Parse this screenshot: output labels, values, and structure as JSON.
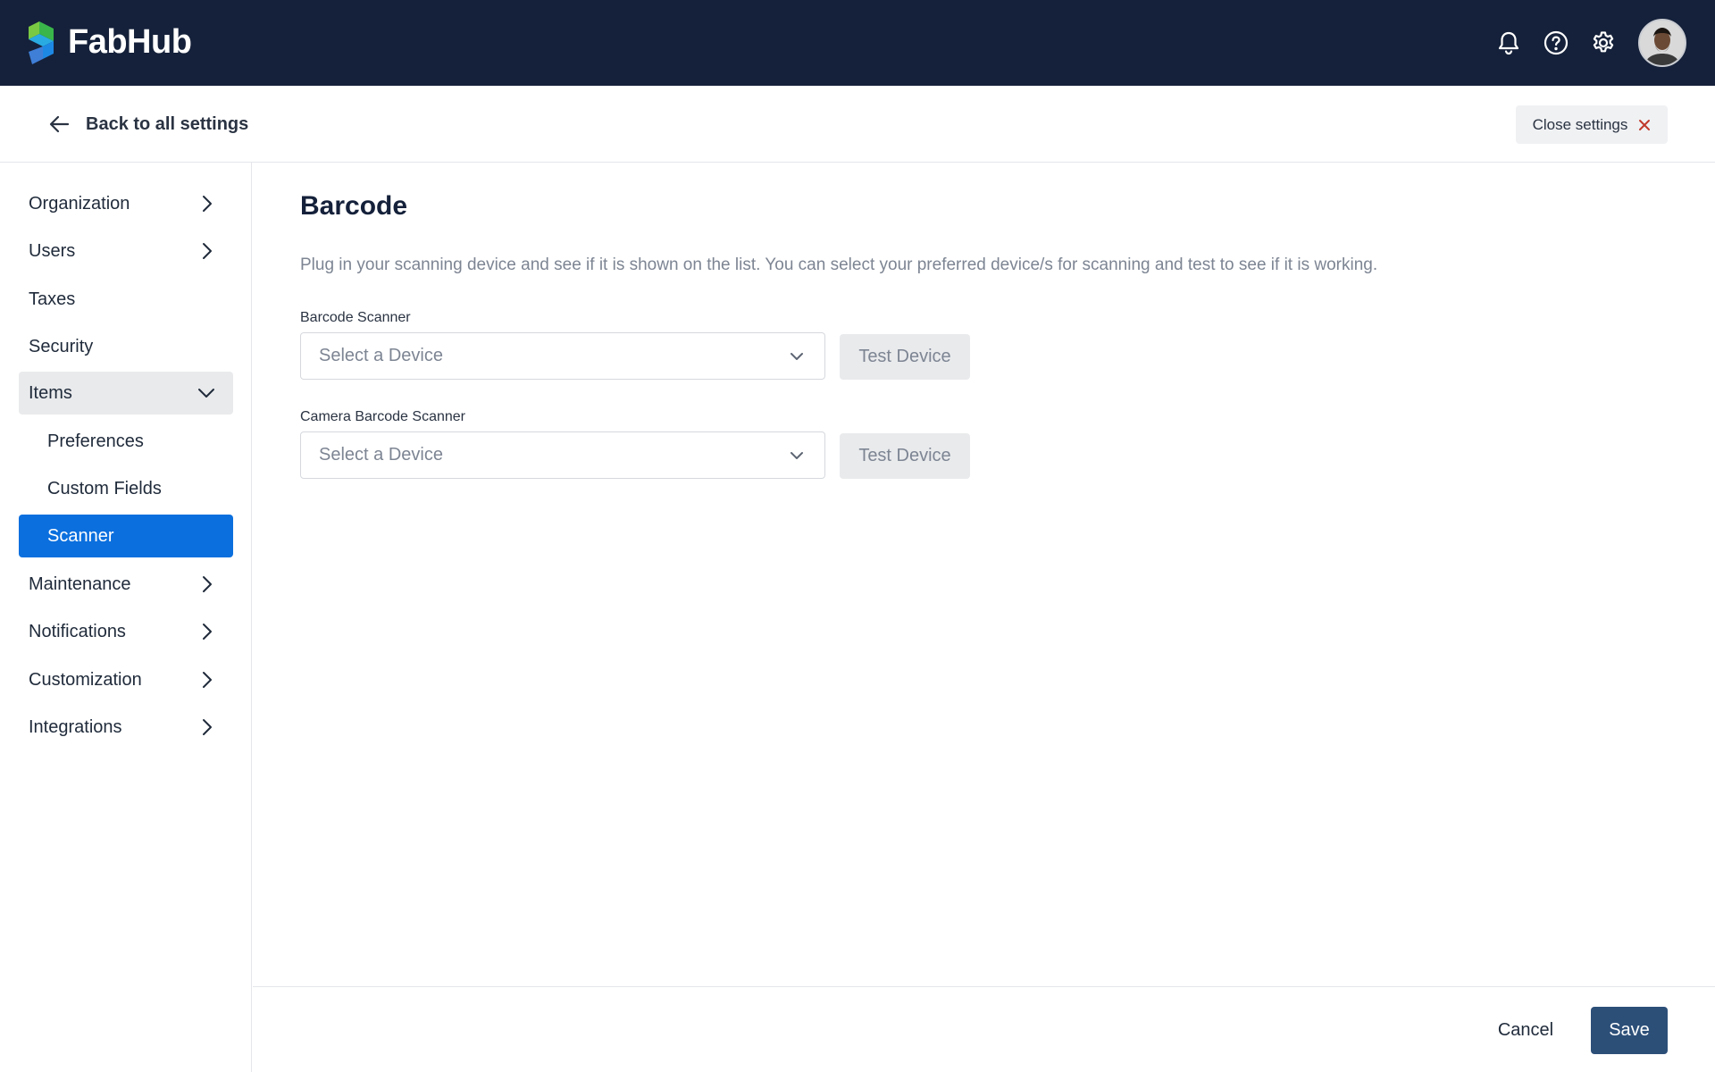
{
  "app": {
    "brand": "FabHub"
  },
  "header": {
    "icons": [
      "bell-icon",
      "help-icon",
      "gear-icon"
    ],
    "avatar": "user-avatar"
  },
  "settings_bar": {
    "back_label": "Back to all settings",
    "close_label": "Close settings"
  },
  "sidebar": {
    "items": [
      {
        "label": "Organization",
        "state": "collapsed",
        "has_chevron": true
      },
      {
        "label": "Users",
        "state": "collapsed",
        "has_chevron": true
      },
      {
        "label": "Taxes",
        "has_chevron": false
      },
      {
        "label": "Security",
        "has_chevron": false
      },
      {
        "label": "Items",
        "state": "expanded",
        "has_chevron": true
      },
      {
        "label": "Preferences",
        "sub": true
      },
      {
        "label": "Custom Fields",
        "sub": true
      },
      {
        "label": "Scanner",
        "sub": true,
        "active": true
      },
      {
        "label": "Maintenance",
        "state": "collapsed",
        "has_chevron": true
      },
      {
        "label": "Notifications",
        "state": "collapsed",
        "has_chevron": true
      },
      {
        "label": "Customization",
        "state": "collapsed",
        "has_chevron": true
      },
      {
        "label": "Integrations",
        "state": "collapsed",
        "has_chevron": true
      }
    ]
  },
  "main": {
    "title": "Barcode",
    "description": "Plug in your scanning device and see if it is shown on the list. You can select your preferred device/s for scanning and test to see if it is working.",
    "fields": [
      {
        "label": "Barcode Scanner",
        "placeholder": "Select a Device",
        "button": "Test Device"
      },
      {
        "label": "Camera Barcode Scanner",
        "placeholder": "Select a Device",
        "button": "Test Device"
      }
    ]
  },
  "footer": {
    "cancel_label": "Cancel",
    "save_label": "Save"
  },
  "colors": {
    "header_bg": "#15213a",
    "active_nav": "#0b6fde",
    "save_button": "#2c4f78",
    "close_x": "#c0392b"
  }
}
